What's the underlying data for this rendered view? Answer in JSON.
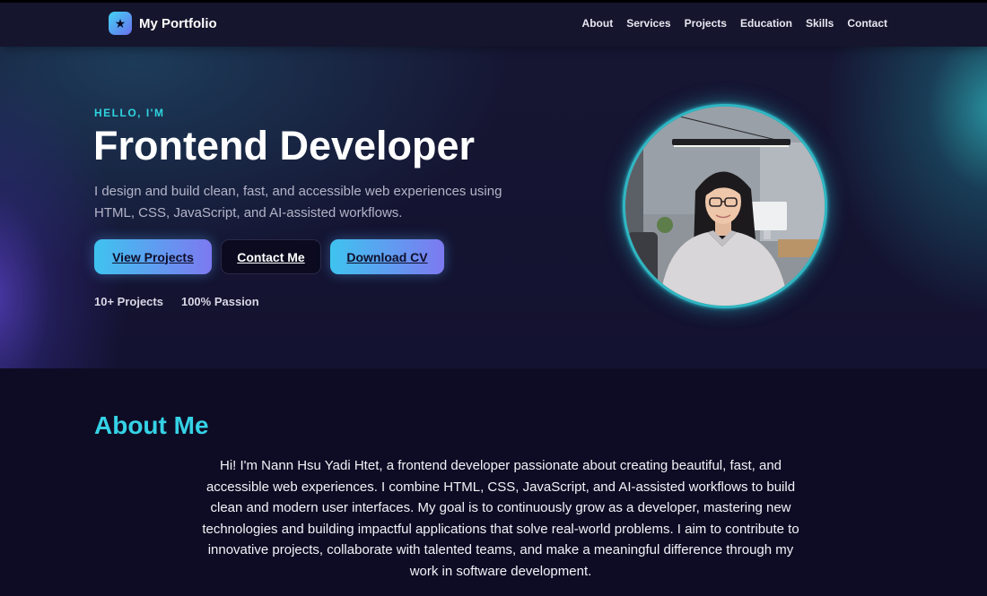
{
  "nav": {
    "brand_logo_icon": "star-icon",
    "brand_name": "My Portfolio",
    "links": [
      "About",
      "Services",
      "Projects",
      "Education",
      "Skills",
      "Contact"
    ]
  },
  "hero": {
    "eyebrow": "HELLO, I'M",
    "headline": "Frontend Developer",
    "tagline": "I design and build clean, fast, and accessible web experiences using HTML, CSS, JavaScript, and AI-assisted workflows.",
    "buttons": {
      "view_projects": "View Projects",
      "contact_me": "Contact Me",
      "download_cv": "Download CV"
    },
    "stats": [
      "10+ Projects",
      "100% Passion"
    ]
  },
  "about": {
    "title": "About Me",
    "text": "Hi! I'm Nann Hsu Yadi Htet, a frontend developer passionate about creating beautiful, fast, and accessible web experiences. I combine HTML, CSS, JavaScript, and AI-assisted workflows to build clean and modern user interfaces. My goal is to continuously grow as a developer, mastering new technologies and building impactful applications that solve real-world problems. I aim to contribute to innovative projects, collaborate with talented teams, and make a meaningful difference through my work in software development."
  },
  "colors": {
    "accent_cyan": "#35d2e6",
    "accent_violet": "#7d79f0",
    "background": "#0e0c24"
  }
}
